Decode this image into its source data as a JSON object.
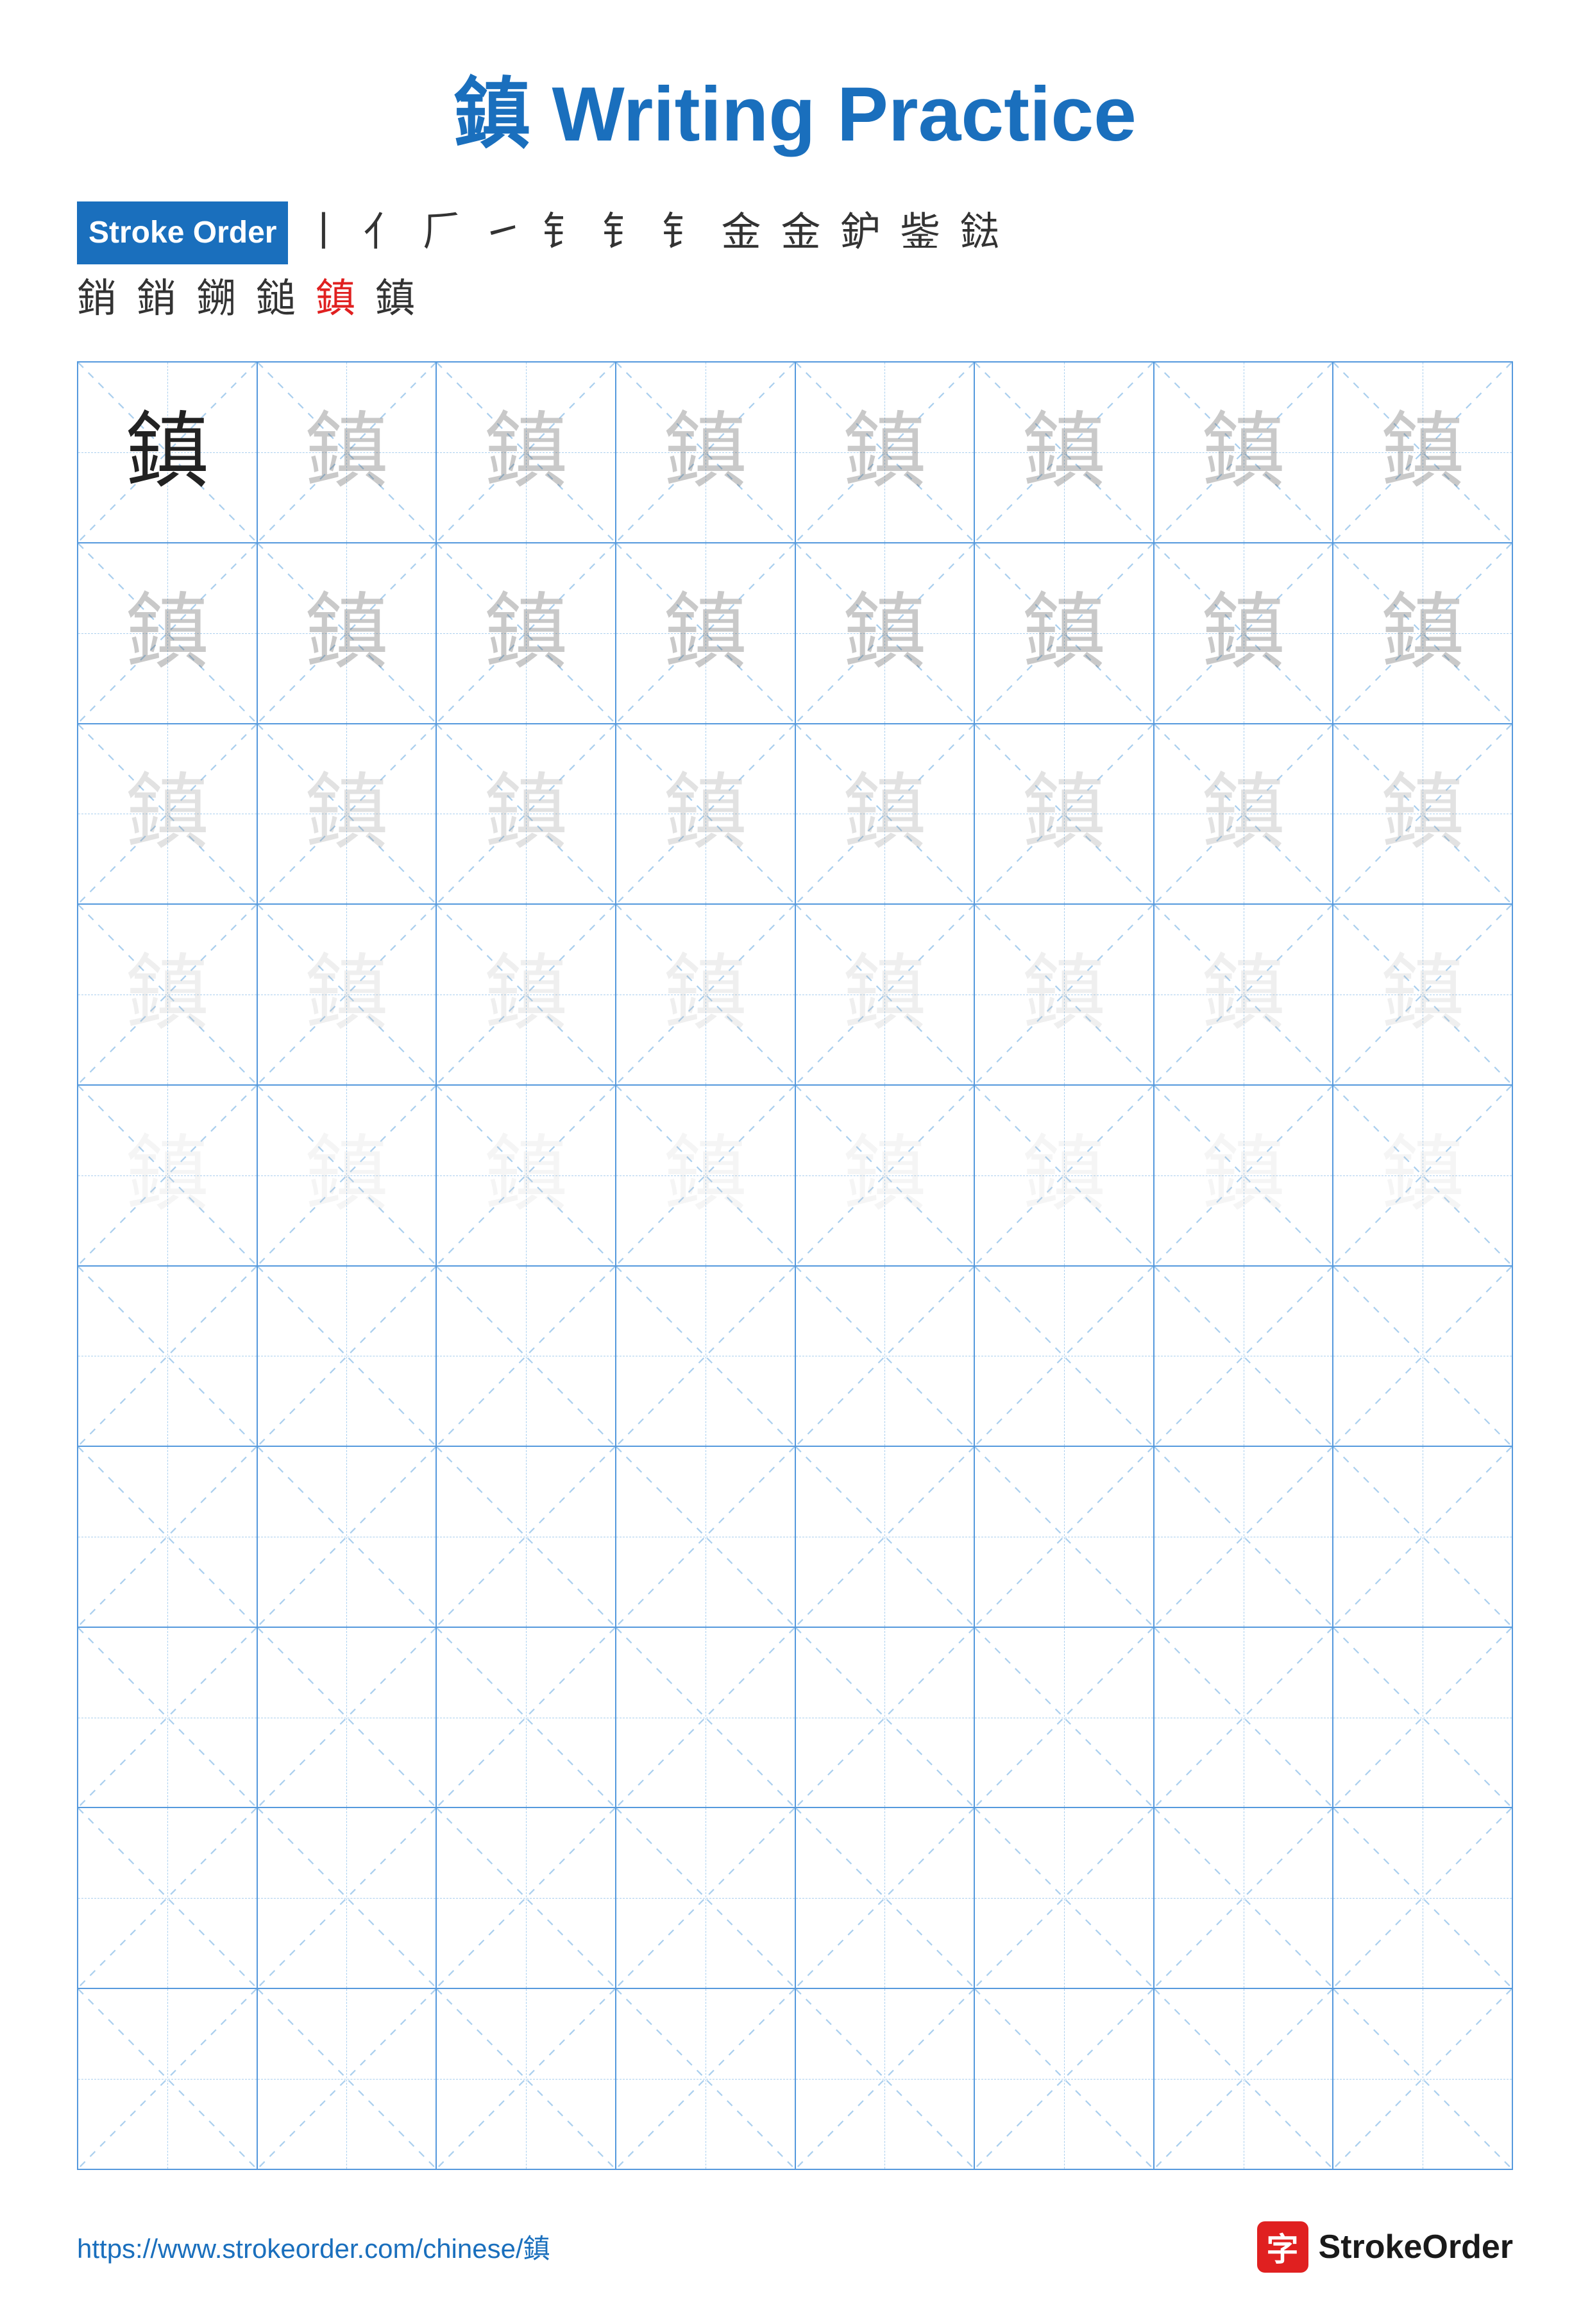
{
  "title": {
    "char": "鎮",
    "text": " Writing Practice",
    "full": "鎮 Writing Practice"
  },
  "stroke_order": {
    "label": "Stroke Order",
    "line1_chars": [
      "丨",
      "亻",
      "𠂉",
      "𠂊",
      "釒",
      "釒",
      "釒",
      "金",
      "金",
      "鈩",
      "鈩",
      "鍅"
    ],
    "line1_raw": "丨 亻 𠂉 ㇀ 釒 釒 釒 金 金 鈩 鈩 鍅",
    "line2_chars": [
      "銷",
      "銷",
      "鎙",
      "鎚",
      "鎮",
      "鎮"
    ],
    "line2_has_red": [
      false,
      false,
      false,
      false,
      true,
      false
    ],
    "stroke_sequence": "丨 亻 𠂉 ㇀ 釒 釒 釒 金 金",
    "strokes_line1": "丨 亻 𠂆 ㇀ 钅 钅 钅 金 金 鈩 鈭 鍅",
    "strokes_line2": "銷 銷 鎙 鎚 鎮 鎮"
  },
  "grid": {
    "rows": 10,
    "cols": 8,
    "char": "鎮",
    "opacity_rows": [
      [
        "dark",
        "light1",
        "light1",
        "light1",
        "light1",
        "light1",
        "light1",
        "light1"
      ],
      [
        "light1",
        "light1",
        "light1",
        "light1",
        "light1",
        "light1",
        "light1",
        "light1"
      ],
      [
        "light2",
        "light2",
        "light2",
        "light2",
        "light2",
        "light2",
        "light2",
        "light2"
      ],
      [
        "light3",
        "light3",
        "light3",
        "light3",
        "light3",
        "light3",
        "light3",
        "light3"
      ],
      [
        "light4",
        "light4",
        "light4",
        "light4",
        "light4",
        "light4",
        "light4",
        "light4"
      ],
      [
        "empty",
        "empty",
        "empty",
        "empty",
        "empty",
        "empty",
        "empty",
        "empty"
      ],
      [
        "empty",
        "empty",
        "empty",
        "empty",
        "empty",
        "empty",
        "empty",
        "empty"
      ],
      [
        "empty",
        "empty",
        "empty",
        "empty",
        "empty",
        "empty",
        "empty",
        "empty"
      ],
      [
        "empty",
        "empty",
        "empty",
        "empty",
        "empty",
        "empty",
        "empty",
        "empty"
      ],
      [
        "empty",
        "empty",
        "empty",
        "empty",
        "empty",
        "empty",
        "empty",
        "empty"
      ]
    ]
  },
  "footer": {
    "url": "https://www.strokeorder.com/chinese/鎮",
    "logo_char": "字",
    "logo_text": "StrokeOrder"
  }
}
